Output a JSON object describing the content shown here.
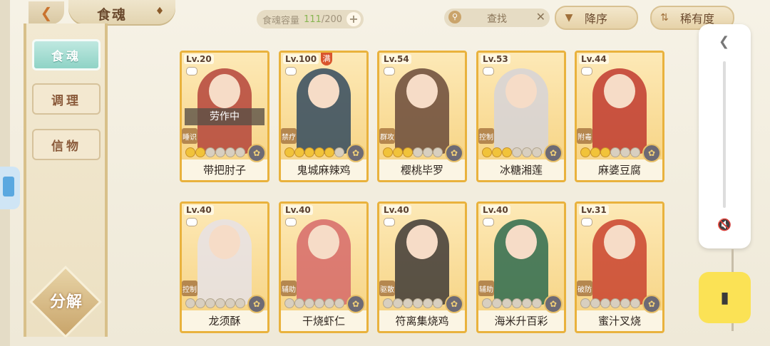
{
  "topbar": {
    "title": "食魂",
    "capacity_label": "食魂容量",
    "capacity_current": "111",
    "capacity_max": "/200",
    "search_placeholder": "查找",
    "sort_order": "降序",
    "sort_by": "稀有度"
  },
  "sidebar": {
    "items": [
      {
        "label": "食魂",
        "active": true
      },
      {
        "label": "调理",
        "active": false
      },
      {
        "label": "信物",
        "active": false
      }
    ],
    "decompose_label": "分解"
  },
  "cards": [
    {
      "level": "Lv.20",
      "name": "带把肘子",
      "role": "睡识",
      "stars": 2,
      "status": "劳作中",
      "color": "#b4443b"
    },
    {
      "level": "Lv.100",
      "name": "鬼城麻辣鸡",
      "role": "禁疗",
      "stars": 5,
      "badge": "满",
      "color": "#334a5e"
    },
    {
      "level": "Lv.54",
      "name": "樱桃毕罗",
      "role": "群攻",
      "stars": 3,
      "color": "#6a4a3a"
    },
    {
      "level": "Lv.53",
      "name": "冰糖湘莲",
      "role": "控制",
      "stars": 3,
      "color": "#d6d3d8"
    },
    {
      "level": "Lv.44",
      "name": "麻婆豆腐",
      "role": "附毒",
      "stars": 3,
      "color": "#c03a2f"
    },
    {
      "level": "Lv.40",
      "name": "龙须酥",
      "role": "控制",
      "stars": 0,
      "color": "#e6e2e6"
    },
    {
      "level": "Lv.40",
      "name": "干烧虾仁",
      "role": "辅助",
      "stars": 0,
      "color": "#d66a6a"
    },
    {
      "level": "Lv.40",
      "name": "符离集烧鸡",
      "role": "驱散",
      "stars": 0,
      "color": "#3e3a36"
    },
    {
      "level": "Lv.40",
      "name": "海米升百彩",
      "role": "辅助",
      "stars": 0,
      "color": "#2e6b4f"
    },
    {
      "level": "Lv.31",
      "name": "蜜汁叉烧",
      "role": "破防",
      "stars": 0,
      "color": "#c9432f"
    }
  ]
}
